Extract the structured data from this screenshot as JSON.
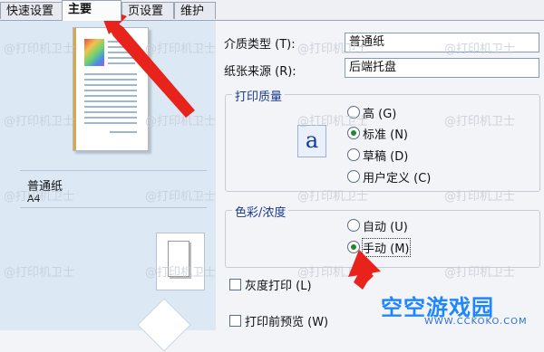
{
  "tabs": [
    "快速设置",
    "主要",
    "页设置",
    "维护"
  ],
  "paper": {
    "name": "普通纸",
    "size": "A4"
  },
  "media_type": {
    "label": "介质类型 (T):",
    "value": "普通纸"
  },
  "paper_source": {
    "label": "纸张来源 (R):",
    "value": "后端托盘"
  },
  "print_quality": {
    "title": "打印质量",
    "options": [
      "高 (G)",
      "标准 (N)",
      "草稿 (D)",
      "用户定义 (C)"
    ],
    "selected": 1
  },
  "color_intensity": {
    "title": "色彩/浓度",
    "options": [
      "自动 (U)",
      "手动 (M)"
    ],
    "selected": 1
  },
  "grayscale": "灰度打印 (L)",
  "preview_before": "打印前预览 (W)",
  "watermark": "@打印机卫士",
  "logo": {
    "name": "空空游戏园",
    "url": "WWW.CCKOKO.COM"
  },
  "colors": {
    "arrow": "#e8231c",
    "check_green": "#1e8a2a",
    "logo_blue": "#1f86ff"
  }
}
